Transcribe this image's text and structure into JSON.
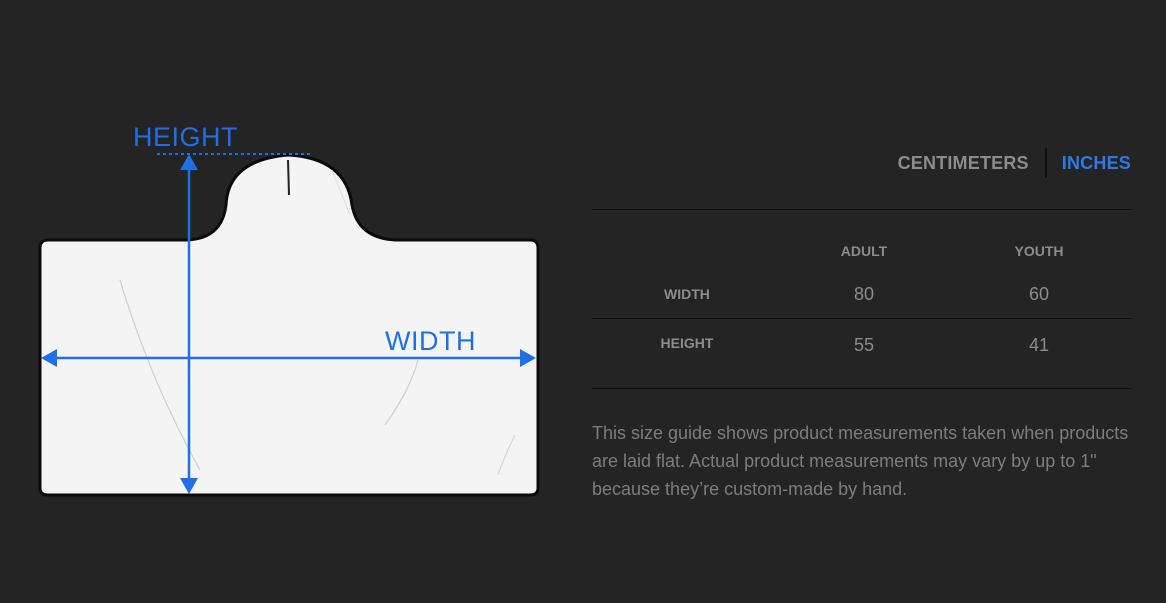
{
  "diagram": {
    "height_label": "HEIGHT",
    "width_label": "WIDTH",
    "accent_color": "#1f6fe5",
    "icon": "hooded-towel-outline"
  },
  "units": {
    "centimeters": "CENTIMETERS",
    "inches": "INCHES",
    "selected": "INCHES"
  },
  "table": {
    "columns": [
      "ADULT",
      "YOUTH"
    ],
    "rows": [
      {
        "label": "WIDTH",
        "adult": "80",
        "youth": "60"
      },
      {
        "label": "HEIGHT",
        "adult": "55",
        "youth": "41"
      }
    ]
  },
  "note": "This size guide shows product measurements taken when products are laid flat. Actual product measurements may vary by up to 1\" because they’re custom-made by hand."
}
